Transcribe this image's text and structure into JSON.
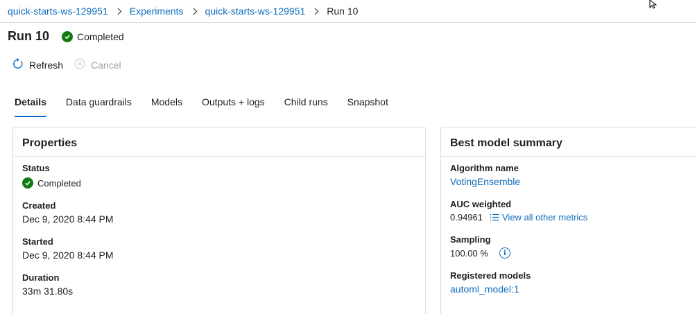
{
  "breadcrumb": {
    "items": [
      "quick-starts-ws-129951",
      "Experiments",
      "quick-starts-ws-129951"
    ],
    "current": "Run 10"
  },
  "header": {
    "title": "Run 10",
    "status": "Completed"
  },
  "toolbar": {
    "refresh_label": "Refresh",
    "cancel_label": "Cancel"
  },
  "tabs": [
    "Details",
    "Data guardrails",
    "Models",
    "Outputs + logs",
    "Child runs",
    "Snapshot"
  ],
  "properties": {
    "title": "Properties",
    "status_label": "Status",
    "status_value": "Completed",
    "created_label": "Created",
    "created_value": "Dec 9, 2020 8:44 PM",
    "started_label": "Started",
    "started_value": "Dec 9, 2020 8:44 PM",
    "duration_label": "Duration",
    "duration_value": "33m 31.80s"
  },
  "best_model": {
    "title": "Best model summary",
    "algorithm_label": "Algorithm name",
    "algorithm_value": "VotingEnsemble",
    "auc_label": "AUC weighted",
    "auc_value": "0.94961",
    "metrics_link": "View all other metrics",
    "sampling_label": "Sampling",
    "sampling_value": "100.00 %",
    "registered_label": "Registered models",
    "registered_value": "automl_model:1"
  },
  "colors": {
    "link": "#0f6cbd",
    "success": "#107c10",
    "disabled": "#a19f9d"
  }
}
